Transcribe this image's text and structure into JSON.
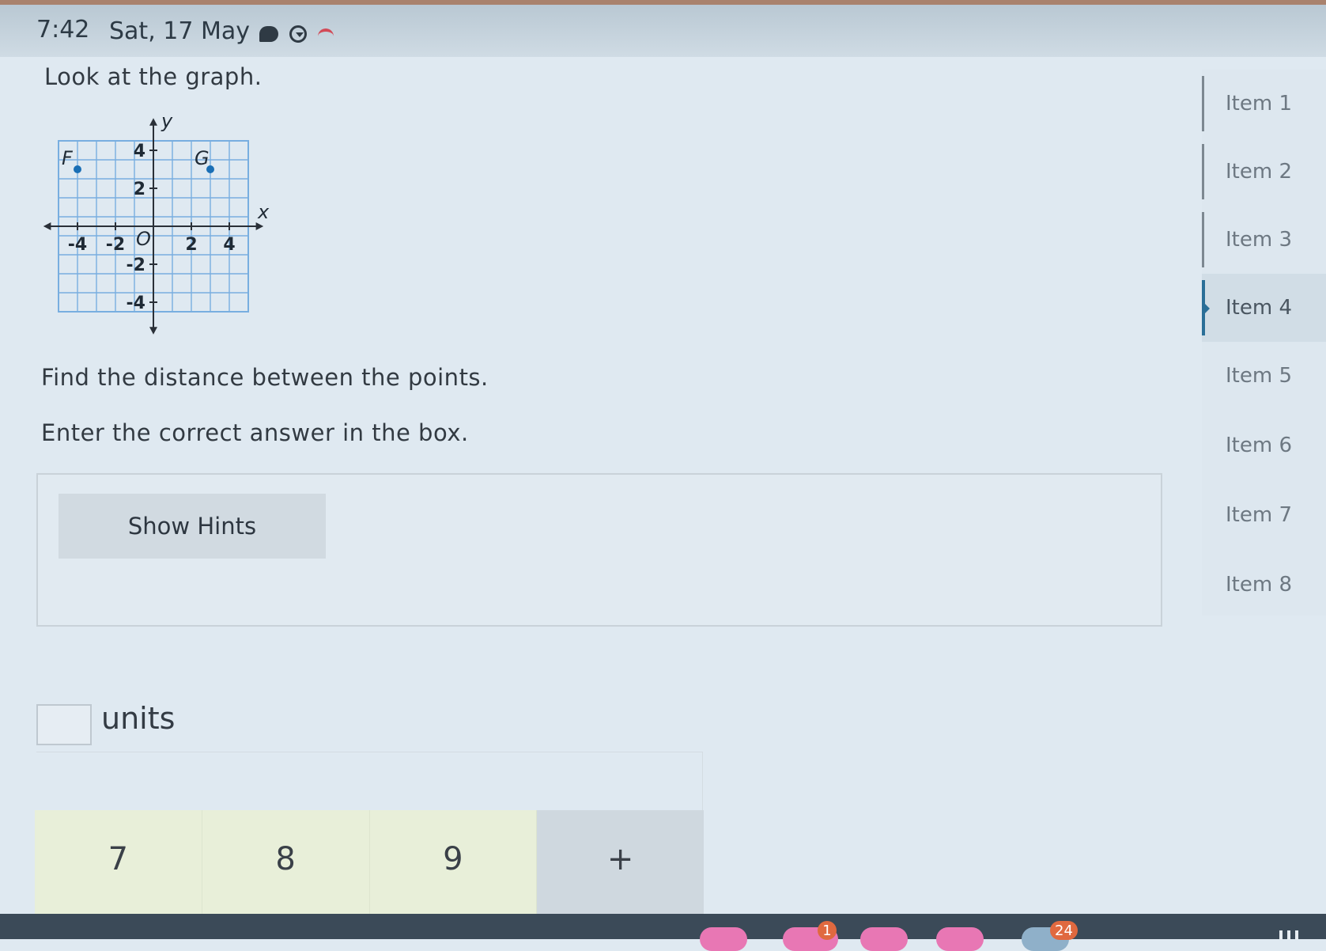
{
  "status": {
    "time": "7:42",
    "date": "Sat, 17 May"
  },
  "question": {
    "intro": "Look at the graph.",
    "instruction": "Find the distance between the points.",
    "direction": "Enter the correct answer in the box.",
    "hint_label": "Show Hints",
    "answer_value": "",
    "units_label": "units"
  },
  "graph": {
    "x_axis_label": "x",
    "y_axis_label": "y",
    "origin_label": "O",
    "x_ticks": [
      "-4",
      "-2",
      "2",
      "4"
    ],
    "y_ticks": [
      "4",
      "2",
      "-2",
      "-4"
    ],
    "points": [
      {
        "label": "F",
        "x": -4,
        "y": 3
      },
      {
        "label": "G",
        "x": 3,
        "y": 3
      }
    ],
    "point_color": "#1a6fb5",
    "grid_color": "#78aee0"
  },
  "keypad": {
    "keys": [
      "7",
      "8",
      "9",
      "+"
    ]
  },
  "sidebar": {
    "items": [
      {
        "label": "Item 1",
        "active": false
      },
      {
        "label": "Item 2",
        "active": false
      },
      {
        "label": "Item 3",
        "active": false
      },
      {
        "label": "Item 4",
        "active": true
      },
      {
        "label": "Item 5",
        "active": false
      },
      {
        "label": "Item 6",
        "active": false
      },
      {
        "label": "Item 7",
        "active": false
      },
      {
        "label": "Item 8",
        "active": false
      }
    ]
  },
  "taskbar": {
    "badge_1": "1",
    "badge_2": "24"
  }
}
